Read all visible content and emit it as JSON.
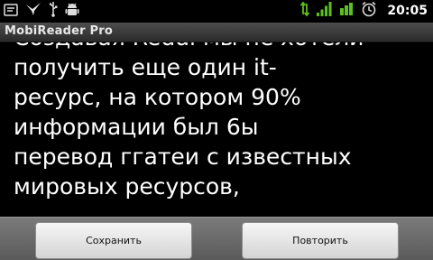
{
  "status_bar": {
    "time": "20:05",
    "left_icons": [
      "notification-icon",
      "bird-icon",
      "usb-icon",
      "android-debug-icon"
    ],
    "right_icons": [
      "data-arrows-icon",
      "signal-icon",
      "wifi-icon",
      "alarm-icon"
    ]
  },
  "app": {
    "title": "MobiReader Pro"
  },
  "reader": {
    "lines": [
      "Создавая Reddi мы не хотели",
      "получить еще один it-",
      "ресурс, на котором 90%",
      "информации был 6ы",
      "перевод ггатеи с известных",
      "мировых ресурсов,"
    ]
  },
  "buttons": {
    "save_label": "Сохранить",
    "repeat_label": "Повторить"
  },
  "colors": {
    "status_green": "#5cbf1f",
    "background": "#000000",
    "text": "#ffffff"
  }
}
